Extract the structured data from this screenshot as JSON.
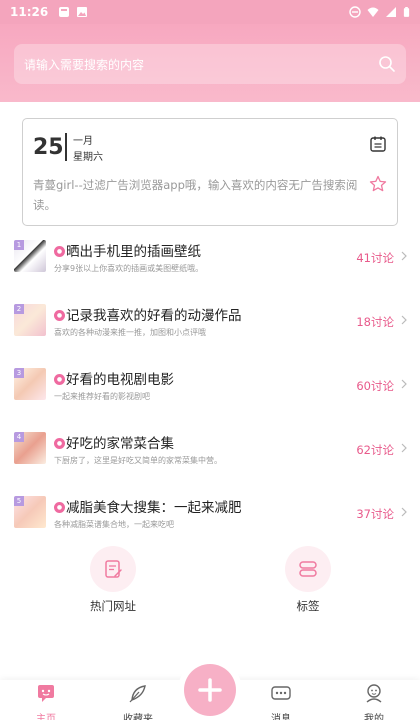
{
  "status_bar": {
    "time": "11:26"
  },
  "search": {
    "placeholder": "请输入需要搜索的内容"
  },
  "date_card": {
    "day": "25",
    "month": "一月",
    "weekday": "星期六",
    "description": "青蔓girl--过滤广告浏览器app哦，输入喜欢的内容无广告搜索阅读。"
  },
  "topics": [
    {
      "rank": "1",
      "title": "晒出手机里的插画壁纸",
      "subtitle": "分享9张以上你喜欢的插画或美图壁纸哦。",
      "count": "41讨论"
    },
    {
      "rank": "2",
      "title": "记录我喜欢的好看的动漫作品",
      "subtitle": "喜欢的各种动漫来推一推，加图和小点评哦",
      "count": "18讨论"
    },
    {
      "rank": "3",
      "title": "好看的电视剧电影",
      "subtitle": "一起来推荐好看的影视剧吧",
      "count": "60讨论"
    },
    {
      "rank": "4",
      "title": "好吃的家常菜合集",
      "subtitle": "下厨房了，这里是好吃又简单的家常菜集中营。",
      "count": "62讨论"
    },
    {
      "rank": "5",
      "title": "减脂美食大搜集：一起来减肥",
      "subtitle": "各种减脂菜谱集合地，一起来吃吧",
      "count": "37讨论"
    }
  ],
  "quick_links": {
    "hot_sites": "热门网址",
    "tags": "标签"
  },
  "tabbar": {
    "home": "主页",
    "favorites": "收藏夹",
    "messages": "消息",
    "mine": "我的"
  },
  "colors": {
    "primary_pink": "#f7a8c0",
    "accent": "#e85a8b"
  }
}
